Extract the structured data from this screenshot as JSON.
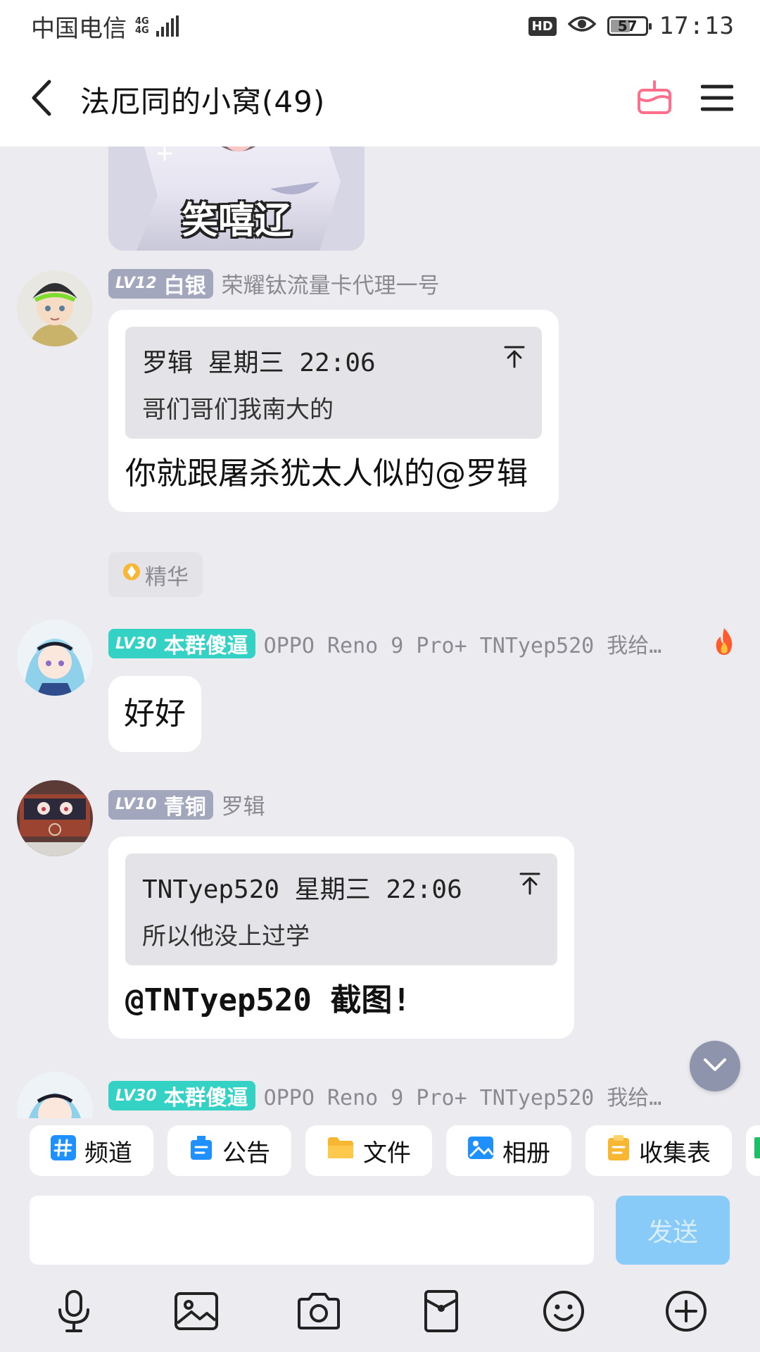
{
  "status_bar": {
    "carrier": "中国电信",
    "network_top": "4G",
    "network_bottom": "4G",
    "hd": "HD",
    "battery": "57",
    "battery_fraction": 0.57,
    "time": "17:13"
  },
  "header": {
    "title": "法厄同的小窝(49)",
    "icons": [
      "back-arrow-icon",
      "cake-icon",
      "menu-icon"
    ],
    "cake_color": "#ff6f8c"
  },
  "sticker": {
    "caption": "笑嘻辽"
  },
  "messages": [
    {
      "level": "LV12",
      "rank": "白银",
      "sender": "荣耀钛流量卡代理一号",
      "quote": {
        "header": "罗辑  星期三 22:06",
        "text": "哥们哥们我南大的"
      },
      "body": "你就跟屠杀犹太人似的@罗辑"
    },
    {
      "essence_label": "精华"
    },
    {
      "level": "LV30",
      "rank": "本群傻逼",
      "sender": "OPPO Reno 9 Pro+ TNTyep520 我给…",
      "body": "好好"
    },
    {
      "level": "LV10",
      "rank": "青铜",
      "sender": "罗辑",
      "quote": {
        "header": "TNTyep520 星期三 22:06",
        "text": "所以他没上过学"
      },
      "body": "@TNTyep520 截图!"
    },
    {
      "level": "LV30",
      "rank": "本群傻逼",
      "sender": "OPPO Reno 9 Pro+ TNTyep520 我给…"
    }
  ],
  "shortcuts": [
    {
      "label": "频道",
      "icon": "channel-hash-icon",
      "color": "#1e90ff"
    },
    {
      "label": "公告",
      "icon": "announcement-icon",
      "color": "#1e90ff"
    },
    {
      "label": "文件",
      "icon": "folder-icon",
      "color": "#f7b733"
    },
    {
      "label": "相册",
      "icon": "album-icon",
      "color": "#1e90ff"
    },
    {
      "label": "收集表",
      "icon": "clipboard-icon",
      "color": "#f7b733"
    }
  ],
  "composer": {
    "input_value": "",
    "send_label": "发送",
    "send_color": "#89cbf8"
  },
  "toolbar_icons": [
    "microphone-icon",
    "image-icon",
    "camera-icon",
    "red-packet-icon",
    "emoji-icon",
    "plus-icon"
  ],
  "colors": {
    "level_gray": "#a2a7be",
    "level_teal": "#34d2c5",
    "background": "#ececf0"
  }
}
